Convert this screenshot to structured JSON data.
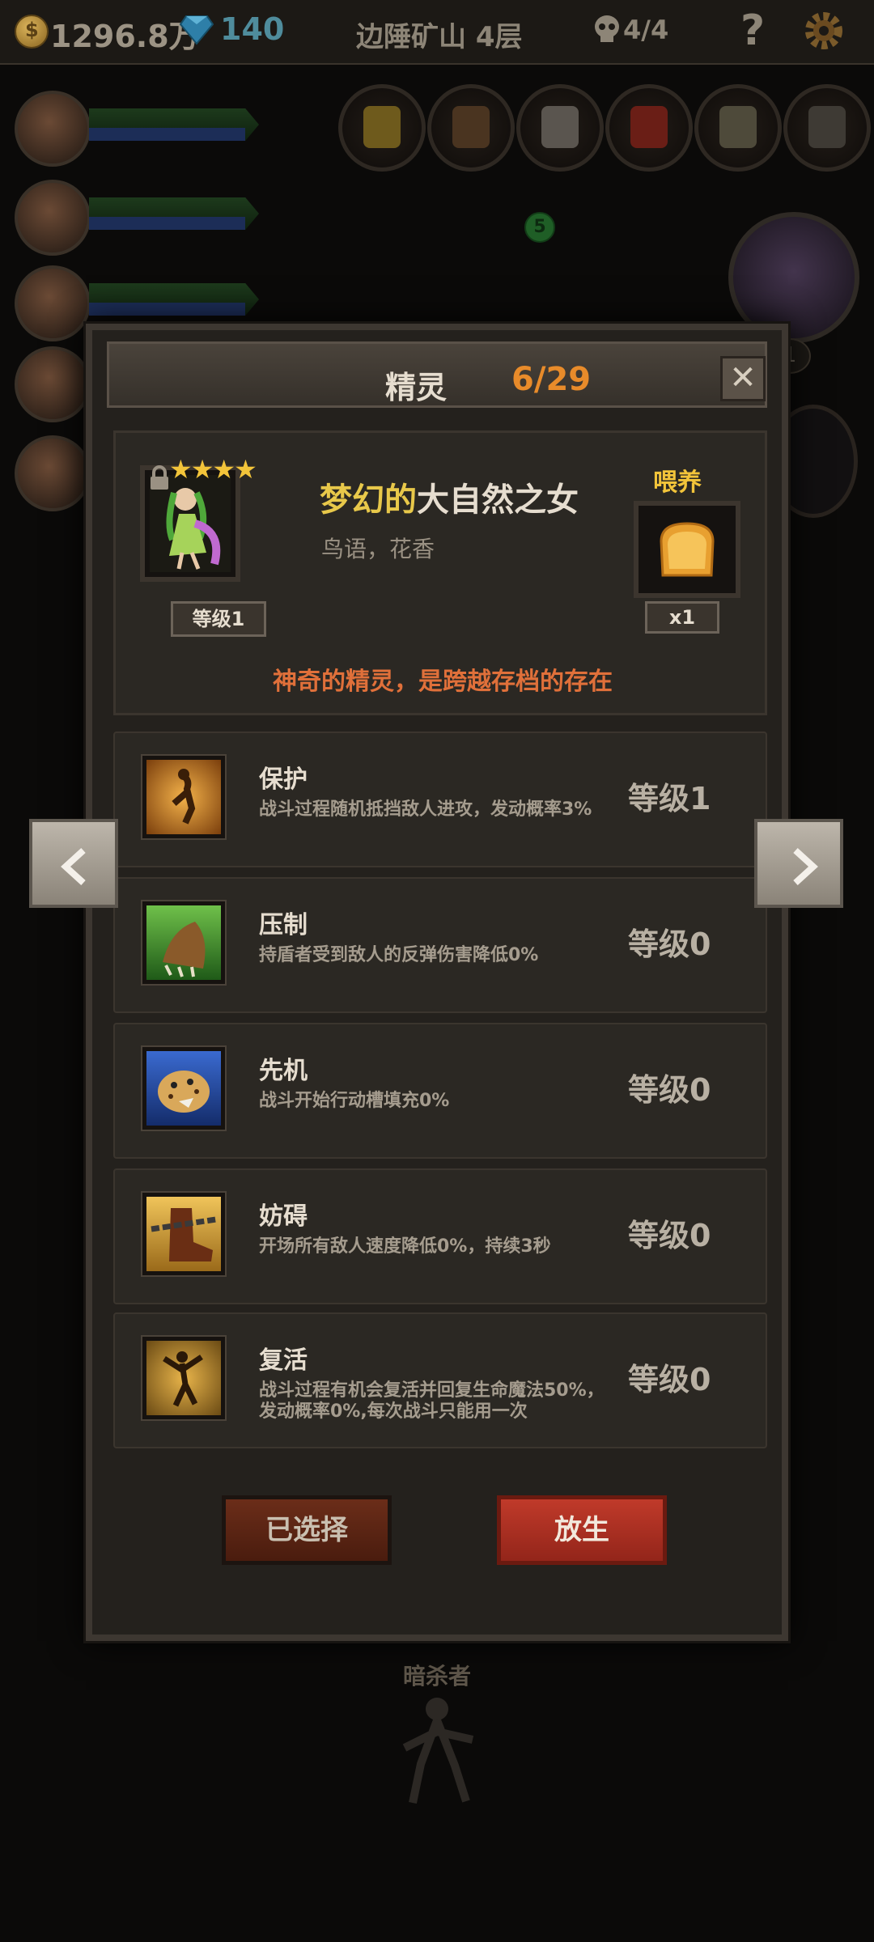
{
  "topbar": {
    "gold": "1296.8万",
    "gems": "140",
    "location": "边陲矿山 4层",
    "wave": "4/4",
    "help_label": "?"
  },
  "background": {
    "green_marker": "5",
    "boss_level": "1",
    "enemy_name": "暗杀者"
  },
  "dialog": {
    "title": "精灵",
    "count": "6/29",
    "close_label": "✕"
  },
  "spirit": {
    "stars": "★★★★",
    "level": "等级1",
    "name_prefix": "梦幻的",
    "name": "大自然之女",
    "subtitle": "鸟语，花香",
    "feed_label": "喂养",
    "food_count": "x1",
    "flavor": "神奇的精灵，是跨越存档的存在"
  },
  "skills": [
    {
      "name": "保护",
      "desc": "战斗过程随机抵挡敌人进攻，发动概率3%",
      "level": "等级1",
      "icon": "shield-dancer-icon",
      "color": "#c07a1c"
    },
    {
      "name": "压制",
      "desc": "持盾者受到敌人的反弹伤害降低0%",
      "level": "等级0",
      "icon": "beast-claw-icon",
      "color": "#3d7a2a"
    },
    {
      "name": "先机",
      "desc": "战斗开始行动槽填充0%",
      "level": "等级0",
      "icon": "leopard-icon",
      "color": "#2e4ea0"
    },
    {
      "name": "妨碍",
      "desc": "开场所有敌人速度降低0%，持续3秒",
      "level": "等级0",
      "icon": "chained-boot-icon",
      "color": "#c89a2c"
    },
    {
      "name": "复活",
      "desc": "战斗过程有机会复活并回复生命魔法50%，发动概率0%,每次战斗只能用一次",
      "level": "等级0",
      "icon": "revive-dancer-icon",
      "color": "#a87a22"
    }
  ],
  "buttons": {
    "selected": "已选择",
    "release": "放生"
  }
}
